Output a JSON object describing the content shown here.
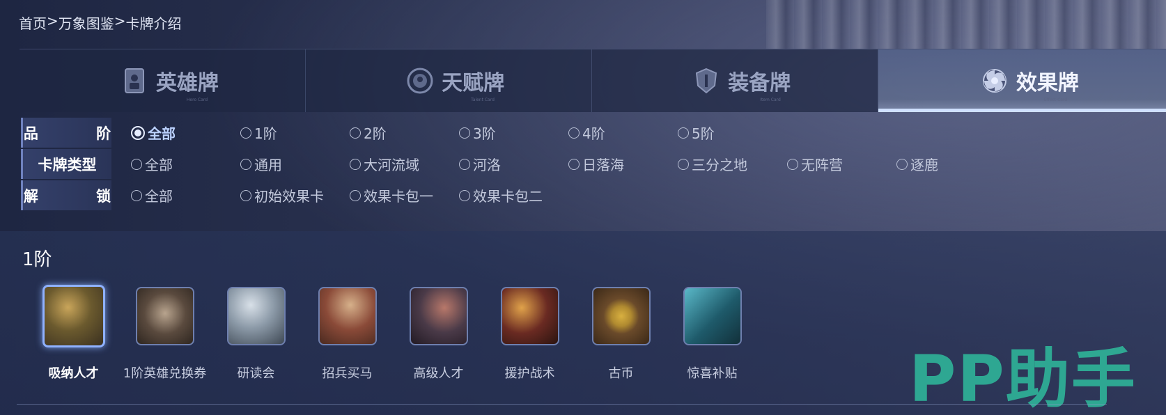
{
  "breadcrumb": [
    "首页",
    ">",
    "万象图鉴",
    ">",
    "卡牌介绍"
  ],
  "tabs": [
    {
      "label": "英雄牌",
      "sub": "Hero Card",
      "icon": "hero-card-icon",
      "active": false
    },
    {
      "label": "天赋牌",
      "sub": "Talent Card",
      "icon": "talent-card-icon",
      "active": false
    },
    {
      "label": "装备牌",
      "sub": "Item Card",
      "icon": "equipment-card-icon",
      "active": false
    },
    {
      "label": "效果牌",
      "sub": "Effect Card",
      "icon": "effect-card-icon",
      "active": true
    }
  ],
  "filters": [
    {
      "label": "品 阶",
      "options": [
        "全部",
        "1阶",
        "2阶",
        "3阶",
        "4阶",
        "5阶"
      ],
      "selected": 0
    },
    {
      "label": "卡牌类型",
      "options": [
        "全部",
        "通用",
        "大河流域",
        "河洛",
        "日落海",
        "三分之地",
        "无阵营",
        "逐鹿"
      ],
      "selected": -1
    },
    {
      "label": "解 锁",
      "options": [
        "全部",
        "初始效果卡",
        "效果卡包一",
        "效果卡包二"
      ],
      "selected": -1
    }
  ],
  "section": {
    "title": "1阶"
  },
  "cards": [
    {
      "name": "吸纳人才",
      "selected": true,
      "colors": [
        "#6b5a2e",
        "#c9a55a",
        "#3a3020"
      ]
    },
    {
      "name": "1阶英雄兑换券",
      "selected": false,
      "colors": [
        "#5a4a3e",
        "#b8a48e",
        "#2e2620"
      ]
    },
    {
      "name": "研读会",
      "selected": false,
      "colors": [
        "#8c9aa8",
        "#d8e0e8",
        "#3e4854"
      ]
    },
    {
      "name": "招兵买马",
      "selected": false,
      "colors": [
        "#8a4a38",
        "#d6b08a",
        "#4a2a20"
      ]
    },
    {
      "name": "高级人才",
      "selected": false,
      "colors": [
        "#4a3a48",
        "#b8786a",
        "#221a24"
      ]
    },
    {
      "name": "援护战术",
      "selected": false,
      "colors": [
        "#6a2a22",
        "#e0a24a",
        "#2a1410"
      ]
    },
    {
      "name": "古币",
      "selected": false,
      "colors": [
        "#6a4a2a",
        "#d8b040",
        "#3a2818"
      ]
    },
    {
      "name": "惊喜补贴",
      "selected": false,
      "colors": [
        "#1e5a6a",
        "#5ab8c8",
        "#12303a"
      ]
    }
  ],
  "watermark": "PP助手",
  "colors": {
    "accent": "#cfe0ff",
    "watermark": "#2fae96"
  }
}
